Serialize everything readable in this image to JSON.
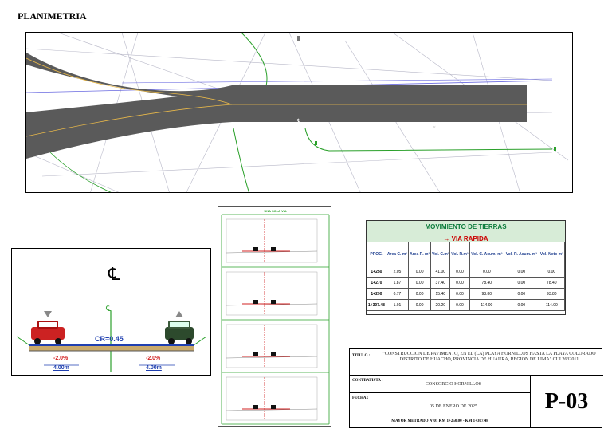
{
  "planimetry": {
    "title": "PLANIMETRIA"
  },
  "cross_section": {
    "centerline_symbol": "℄",
    "axis_symbol": "℄",
    "cr_label": "CR=0.45",
    "left_slope": "-2.0%",
    "right_slope": "-2.0%",
    "left_width": "4.00m",
    "right_width": "4.00m"
  },
  "profiles": {
    "header": "UNA SOLA VIA"
  },
  "earthworks": {
    "title": "MOVIMIENTO DE TIERRAS",
    "subtitle": "VIA RAPIDA",
    "headers": [
      "PROG.",
      "Area C. m²",
      "Area R. m²",
      "Vol. C.m³",
      "Vol. R.m³",
      "Vol. C. Acum. m³",
      "Vol. R. Acum. m³",
      "Vol. Neto m³"
    ],
    "rows": [
      [
        "1+250",
        "2.05",
        "0.00",
        "41.00",
        "0.00",
        "0.00",
        "0.00",
        "0.00"
      ],
      [
        "1+270",
        "1.87",
        "0.00",
        "37.40",
        "0.00",
        "78.40",
        "0.00",
        "78.40"
      ],
      [
        "1+290",
        "0.77",
        "0.00",
        "15.40",
        "0.00",
        "93.80",
        "0.00",
        "93.80"
      ],
      [
        "1+307.48",
        "1.01",
        "0.00",
        "20.20",
        "0.00",
        "114.00",
        "0.00",
        "114.00"
      ]
    ]
  },
  "title_block": {
    "title_label": "TITULO :",
    "title_value": "\"CONSTRUCCION DE PAVIMENTO, EN EL (LA) PLAYA HORNILLOS HASTA LA PLAYA COLORADO DISTRITO DE HUACHO, PROVINCIA DE HUAURA, REGION DE LIMA\" CUI 2632011",
    "contractor_label": "CONTRATISTA :",
    "contractor_value": "CONSORCIO HORNILLOS",
    "date_label": "FECHA :",
    "date_value": "05 DE ENERO DE 2025",
    "footer": "MAYOR METRADO N°01 KM 1+250.00 - KM 1+307.48",
    "sheet_code": "P-03"
  },
  "colors": {
    "road": "#5a5a5a",
    "axis": "#e8b84a",
    "grid_green": "#2aa02a",
    "red_axis": "#d22020",
    "blue_text": "#1f3fb0",
    "table_head": "#1f3f8f",
    "table_title_bg": "#d7ecd7"
  }
}
